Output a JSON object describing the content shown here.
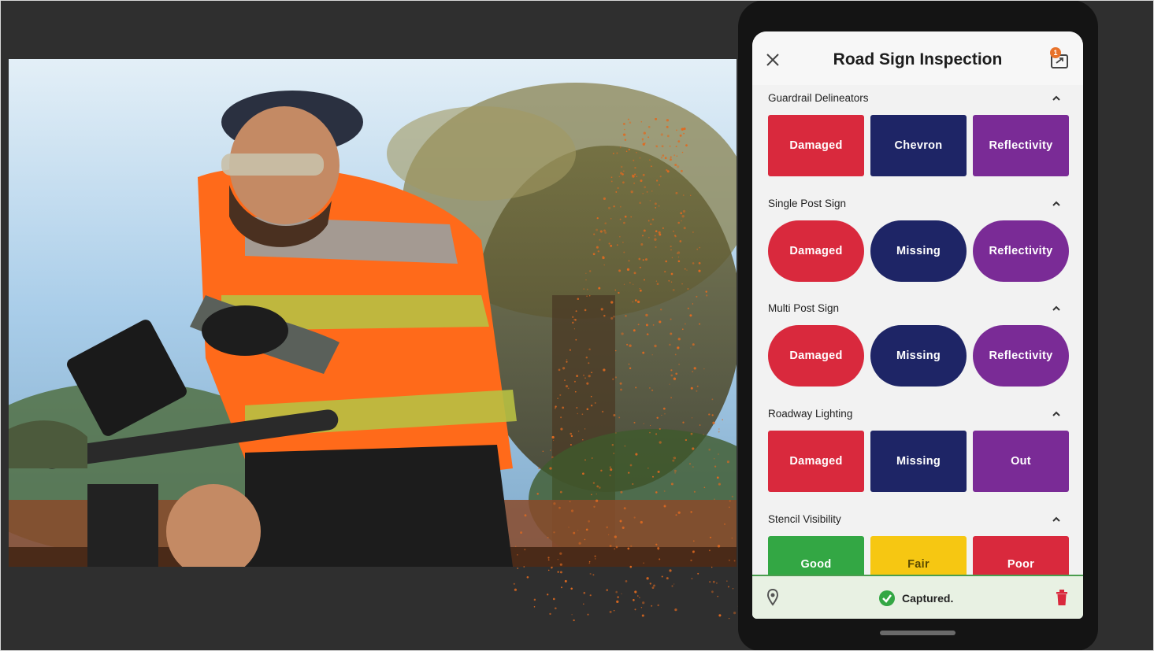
{
  "app": {
    "title": "Road Sign Inspection",
    "outbox_badge": "1"
  },
  "sections": [
    {
      "label": "Guardrail Delineators",
      "shape": "square",
      "buttons": [
        {
          "label": "Damaged",
          "color": "#d9293d"
        },
        {
          "label": "Chevron",
          "color": "#1e2566"
        },
        {
          "label": "Reflectivity",
          "color": "#7a2b96"
        }
      ]
    },
    {
      "label": "Single Post Sign",
      "shape": "pill",
      "buttons": [
        {
          "label": "Damaged",
          "color": "#d9293d"
        },
        {
          "label": "Missing",
          "color": "#1e2566"
        },
        {
          "label": "Reflectivity",
          "color": "#7a2b96"
        }
      ]
    },
    {
      "label": "Multi Post Sign",
      "shape": "pill",
      "buttons": [
        {
          "label": "Damaged",
          "color": "#d9293d"
        },
        {
          "label": "Missing",
          "color": "#1e2566"
        },
        {
          "label": "Reflectivity",
          "color": "#7a2b96"
        }
      ]
    },
    {
      "label": "Roadway Lighting",
      "shape": "square",
      "buttons": [
        {
          "label": "Damaged",
          "color": "#d9293d"
        },
        {
          "label": "Missing",
          "color": "#1e2566"
        },
        {
          "label": "Out",
          "color": "#7a2b96"
        }
      ]
    },
    {
      "label": "Stencil Visibility",
      "shape": "square",
      "buttons": [
        {
          "label": "Good",
          "color": "#33a744"
        },
        {
          "label": "Fair",
          "color": "#f6c712"
        },
        {
          "label": "Poor",
          "color": "#d9293d"
        }
      ]
    }
  ],
  "footer": {
    "status": "Captured.",
    "status_color": "#33a744"
  },
  "icons": {
    "close": "close-icon",
    "outbox": "outbox-icon",
    "collapse": "chevron-up-icon",
    "location": "location-pin-icon",
    "status": "check-circle-icon",
    "delete": "trash-icon"
  }
}
